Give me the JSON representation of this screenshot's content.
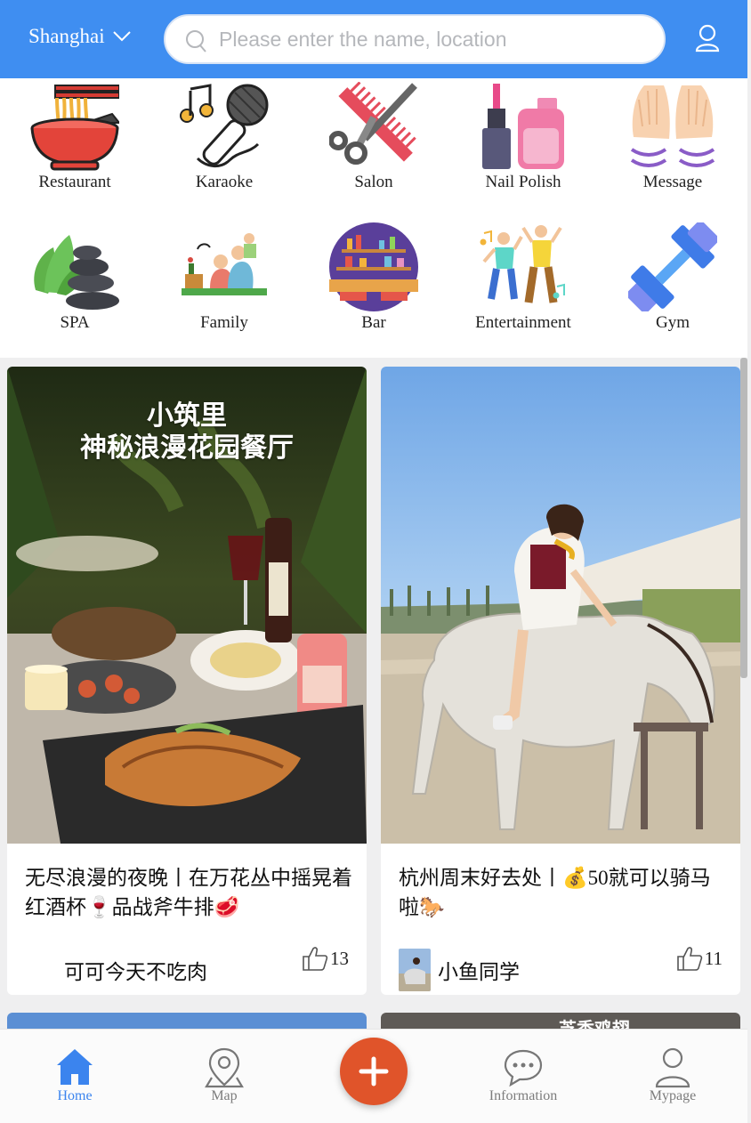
{
  "header": {
    "city": "Shanghai",
    "search_placeholder": "Please enter the name, location"
  },
  "categories": [
    {
      "label": "Restaurant",
      "icon": "noodle-bowl-icon"
    },
    {
      "label": "Karaoke",
      "icon": "microphone-icon"
    },
    {
      "label": "Salon",
      "icon": "comb-scissors-icon"
    },
    {
      "label": "Nail Polish",
      "icon": "nail-polish-icon"
    },
    {
      "label": "Message",
      "icon": "massage-hands-icon"
    },
    {
      "label": "SPA",
      "icon": "spa-stones-icon"
    },
    {
      "label": "Family",
      "icon": "family-picnic-icon"
    },
    {
      "label": "Bar",
      "icon": "bar-shelf-icon"
    },
    {
      "label": "Entertainment",
      "icon": "dancers-icon"
    },
    {
      "label": "Gym",
      "icon": "dumbbell-icon"
    }
  ],
  "feed": {
    "posts": [
      {
        "image_text": [
          "小筑里",
          "神秘浪漫花园餐厅"
        ],
        "title": "无尽浪漫的夜晚丨在万花丛中摇晃着红酒杯🍷品战斧牛排🥩",
        "author": "可可今天不吃肉",
        "likes": "13"
      },
      {
        "image_text": [],
        "title": "杭州周末好去处丨💰50就可以骑马啦🐎",
        "author": "小鱼同学",
        "likes": "11"
      }
    ],
    "partial_post_text": "芝香鸡翅"
  },
  "tabbar": {
    "tabs": [
      {
        "label": "Home",
        "icon": "home-icon",
        "active": true
      },
      {
        "label": "Map",
        "icon": "map-pin-icon",
        "active": false
      },
      {
        "label": "Information",
        "icon": "chat-bubble-icon",
        "active": false
      },
      {
        "label": "Mypage",
        "icon": "user-icon",
        "active": false
      }
    ],
    "add_icon": "plus-icon"
  },
  "colors": {
    "header": "#3f8ef1",
    "active_tab": "#3b84ee",
    "fab": "#e0542a"
  }
}
